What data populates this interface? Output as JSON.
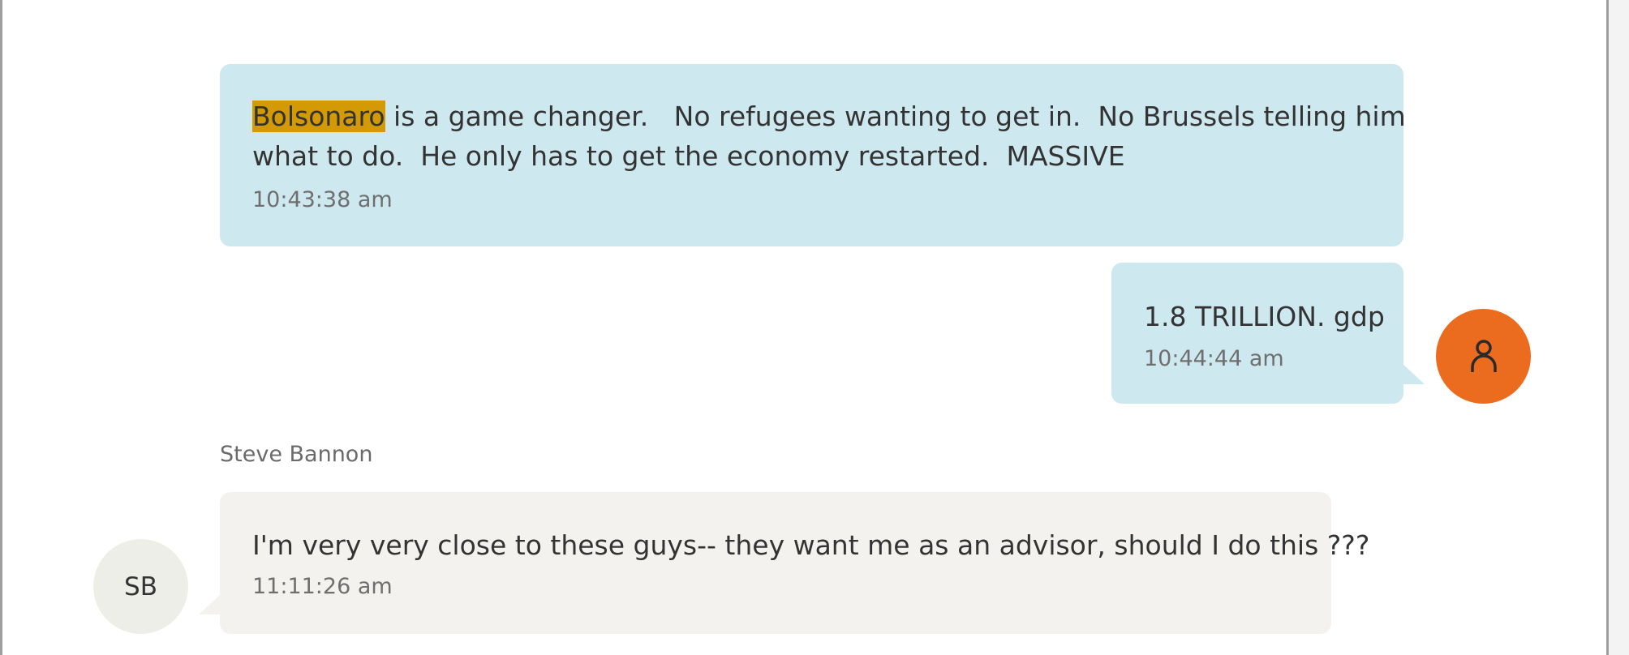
{
  "messages": [
    {
      "direction": "outgoing",
      "highlight": "Bolsonaro",
      "text_line1_rest": " is a game changer.   No refugees wanting to get in.  No Brussels telling him",
      "text_line2": "what to do.  He only has to get the economy restarted.  MASSIVE",
      "time": "10:43:38 am"
    },
    {
      "direction": "outgoing",
      "text": "1.8 TRILLION. gdp",
      "time": "10:44:44 am",
      "avatar_icon": "user-icon"
    },
    {
      "direction": "incoming",
      "sender": "Steve Bannon",
      "avatar_initials": "SB",
      "text": "I'm very very close to these guys-- they want me as an advisor, should I do this ???",
      "time": "11:11:26 am"
    }
  ],
  "colors": {
    "outgoing_bubble": "#cde8ef",
    "incoming_bubble": "#f3f2ef",
    "highlight": "#d49a06",
    "my_avatar": "#ec6c1f",
    "sb_avatar": "#eeeee8"
  }
}
